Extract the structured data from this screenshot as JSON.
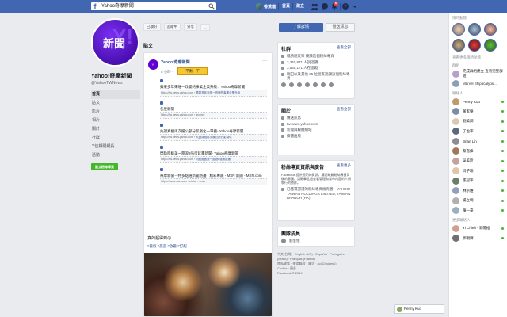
{
  "topbar": {
    "search_value": "Yahoo奇摩新聞",
    "user_name": "香蕉貓",
    "home": "首頁",
    "create": "建立",
    "notif_badge": "6"
  },
  "page": {
    "name": "Yahoo!奇摩新聞",
    "handle": "@YahooTWNews",
    "menu": [
      "首頁",
      "貼文",
      "影片",
      "相片",
      "關於",
      "社群",
      "Y伍相關網長",
      "活動"
    ],
    "create_page": "建立粉絲專頁"
  },
  "actions": {
    "like": "已讚好",
    "follow": "追蹤中",
    "share": "分享",
    "more": "..."
  },
  "cta": {
    "primary": "了解詳情",
    "secondary": "發送訊息"
  },
  "feed": {
    "header": "貼文",
    "author": "Yahoo!奇摩新聞",
    "time": "5 小時 · ",
    "tooltip": "平衡一下",
    "more": "···",
    "entries": [
      {
        "title": "蘋果多年來唯一改變的事業企業升級：Yahoo奇摩新聞",
        "url": "https://tw.news.yahoo.com › ",
        "link": "蘋果多年來唯一改變的事業企業升級"
      },
      {
        "title": "各股新聞",
        "url": "https://tw.news.yahoo.com › archive",
        "link": ""
      },
      {
        "title": "失證真相再次攔公部分影劇化一單攤- Yahoo奇摩新聞",
        "url": "https://tw.news.yahoo.com › ",
        "link": "失證真相再次攔公部分影劇化"
      },
      {
        "title": "閃點陸藝美一圍浪8強蛋延畫新聞- Yahoo奇摩新聞",
        "url": "https://tw.news.yahoo.com › ",
        "link": "閃點陸藝美一圍浪8強蛋延畫"
      },
      {
        "title": "奇摩新聞－特多點選新聞熱議 - 精彩專題 - MSN 新聞 - MSN.com",
        "url": "https://www.msn.com › zh-tw › news",
        "link": ""
      }
    ],
    "caption": "真的超得到😜",
    "tags": "#暑假 #旅遊 #放暑 #打起"
  },
  "about": {
    "community_title": "社群",
    "community_more": "查看全部",
    "community_rows": [
      "邀請朋友來 按讚這個粉絲專頁",
      "3,340,871 人說這讚",
      "3,555,171 人在追蹤",
      "瑞田以及其他 65 位朋友說讚這個粉絲專頁"
    ],
    "about_title": "關於",
    "about_more": "查看全部",
    "about_rows": [
      "傳送訊息",
      "tw.news.yahoo.com",
      "新聞與媒體網站",
      "媒體出版"
    ]
  },
  "ad": {
    "title": "粉絲專頁資訊與廣告",
    "more": "查看更多",
    "text": "Facebook 提供透明的資訊，讓您瞭解粉絲專頁背後的意圖。請點擊此處查看管理和發布內容的人所執行的動作。",
    "owner": "已獲得認證的粉絲專頁擁有者：YAHOO! TAIWAN HOLDINGS LIMITED, TAIWAN BRANCH (HK)"
  },
  "people": {
    "title": "團隊成員",
    "name": "劉奎佑"
  },
  "footer": {
    "lines": [
      "中文(台灣) · English (US) · Español · Português (Brasil) · Français (France)",
      "隱私政策 · 使用條款 · 廣告 · Ad Choices ▷",
      "Cookie · 更多",
      "Facebook © 2019"
    ]
  },
  "chat": {
    "stories_title": "限時動態",
    "groups_title": "群組",
    "stories_more": "查看更多限時動態",
    "group_label": "Marvel Shipocalyps...",
    "group2_label": "完成群組建立 查看完整群組",
    "contacts_title": "聯絡人",
    "contacts": [
      "Penny Kuo",
      "黃家樂",
      "劉美卿",
      "丁治宇",
      "Brian Lin",
      "蔡嘉偉",
      "吳美玲",
      "周子瑜",
      "張冠宇",
      "林宗維",
      "楊立明",
      "陳一豪"
    ],
    "more_contacts_title": "更多聯絡人",
    "more_contacts": [
      "Yi Chieh - 新聞推",
      "郭明輝"
    ],
    "contact_colors": [
      "#c29a6a",
      "#7b8ea8",
      "#d9c9b0",
      "#5a6a7a",
      "#8a8d91",
      "#a07858",
      "#c7a0a0",
      "#e0c6a8",
      "#6b7e6a",
      "#8fa0b8",
      "#b0b0b0",
      "#9ab0c0",
      "#cfa090",
      "#707070"
    ],
    "pill_name": "Penny Kuo"
  }
}
